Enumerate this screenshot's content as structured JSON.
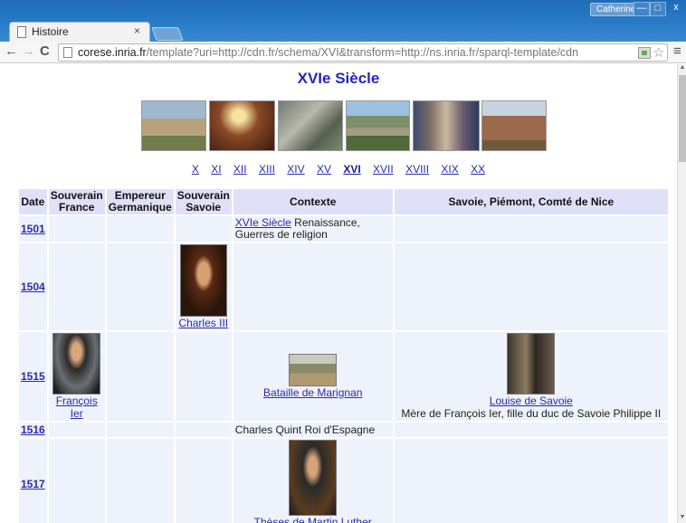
{
  "browser": {
    "tab_title": "Histoire",
    "tab_close": "×",
    "user_name": "Catherine",
    "win_min": "—",
    "win_max": "□",
    "win_close": "x",
    "url_host": "corese.inria.fr",
    "url_path": "/template?uri=http://cdn.fr/schema/XVI&transform=http://ns.inria.fr/sparql-template/cdn",
    "back": "←",
    "forward": "→",
    "reload": "C",
    "star": "☆",
    "menu": "≡"
  },
  "page": {
    "title": "XVIe Siècle",
    "centuries": [
      "X",
      "XI",
      "XII",
      "XIII",
      "XIV",
      "XV",
      "XVI",
      "XVII",
      "XVIII",
      "XIX",
      "XX"
    ],
    "current_century": "XVI"
  },
  "table": {
    "headers": {
      "date": "Date",
      "france": "Souverain France",
      "germanique": "Empereur Germanique",
      "savoie": "Souverain Savoie",
      "contexte": "Contexte",
      "savoie_region": "Savoie, Piémont, Comté de Nice"
    },
    "rows": [
      {
        "date": "1501",
        "contexte_link": "XVIe Siècle",
        "contexte_text": " Renaissance, Guerres de religion"
      },
      {
        "date": "1504",
        "savoie_link": "Charles III"
      },
      {
        "date": "1515",
        "france_link": "François Ier",
        "contexte_link": "Bataille de Marignan",
        "region_link": "Louise de Savoie",
        "region_text": "Mère de François Ier, fille du duc de Savoie Philippe II"
      },
      {
        "date": "1516",
        "contexte_text": "Charles Quint Roi d'Espagne"
      },
      {
        "date": "1517",
        "contexte_link": "Thèses de Martin Luther"
      }
    ]
  }
}
